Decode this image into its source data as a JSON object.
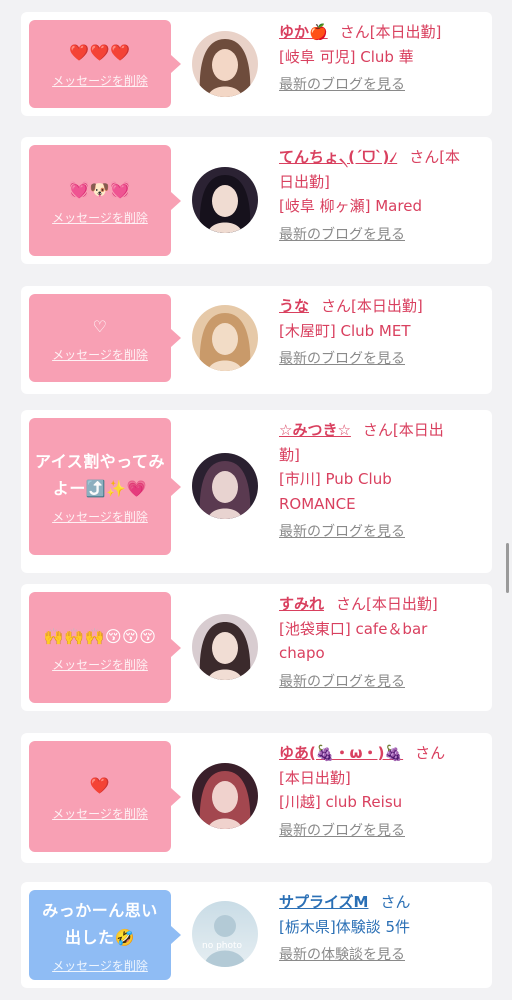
{
  "colors": {
    "pink_bubble": "#f8a0b4",
    "blue_bubble": "#8fbcf4",
    "pink_text": "#d9405f",
    "blue_text": "#2a6fb5",
    "link_gray": "#8a8a8a"
  },
  "cards": [
    {
      "message": "❤️❤️❤️",
      "delete_label": "メッセージを削除",
      "name": "ゆか🍎",
      "suffix": "さん[本日出勤]",
      "detail_lines": [
        "[岐阜 可児] Club 華"
      ],
      "link": "最新のブログを見る",
      "theme": "pink"
    },
    {
      "message": "💓🐶💓",
      "delete_label": "メッセージを削除",
      "name": "てんちょ৲(ˊᗜˋ)৴",
      "suffix": "さん[本",
      "detail_lines": [
        "日出勤]",
        "[岐阜 柳ヶ瀬] Mared"
      ],
      "link": "最新のブログを見る",
      "theme": "pink"
    },
    {
      "message": "♡",
      "delete_label": "メッセージを削除",
      "name": "うな",
      "suffix": "さん[本日出勤]",
      "detail_lines": [
        "[木屋町] Club MET"
      ],
      "link": "最新のブログを見る",
      "theme": "pink"
    },
    {
      "message": "アイス割やってみよー⤴️✨💗",
      "delete_label": "メッセージを削除",
      "name": "☆みつき☆",
      "suffix": "さん[本日出",
      "detail_lines": [
        "勤]",
        "[市川] Pub Club",
        "ROMANCE"
      ],
      "link": "最新のブログを見る",
      "theme": "pink"
    },
    {
      "message": "🙌🙌🙌😚😚😚",
      "delete_label": "メッセージを削除",
      "name": "すみれ",
      "suffix": "さん[本日出勤]",
      "detail_lines": [
        "[池袋東口] cafe＆bar",
        "chapo"
      ],
      "link": "最新のブログを見る",
      "theme": "pink"
    },
    {
      "message": "❤️",
      "delete_label": "メッセージを削除",
      "name": "ゆあ(🍇・ω・)🍇",
      "suffix": "さん",
      "detail_lines": [
        "[本日出勤]",
        "[川越] club Reisu"
      ],
      "link": "最新のブログを見る",
      "theme": "pink"
    },
    {
      "message": "みっかーん思い出した🤣",
      "delete_label": "メッセージを削除",
      "name": "サプライズM",
      "suffix": "さん",
      "detail_lines": [
        "[栃木県]体験談 5件"
      ],
      "link": "最新の体験談を見る",
      "theme": "blue",
      "avatar_text": "no photo"
    }
  ]
}
